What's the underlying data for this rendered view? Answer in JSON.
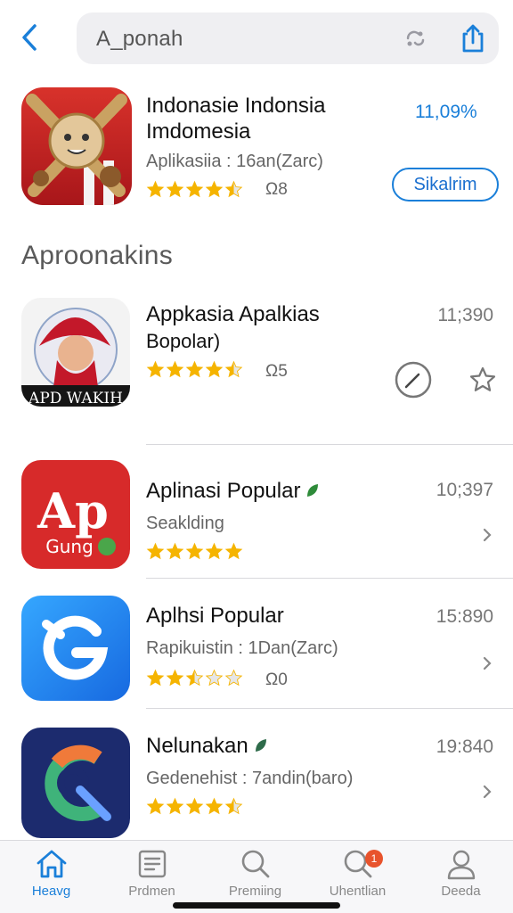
{
  "search": {
    "query": "A_ponah"
  },
  "featured": {
    "title": "Indonasie Indonsia Imdomesia",
    "subtitle": "Aplikasiia : 16an(Zarc)",
    "rating": 4.5,
    "rating_count": "Ω8",
    "percent": "11,09%",
    "button_label": "Sikalrim"
  },
  "section": {
    "heading": "Aproonakins"
  },
  "apps": [
    {
      "title": "Appkasia Apalkias",
      "subtitle": "Bopolar)",
      "rating": 4.5,
      "count": "Ω5",
      "number": "11;390",
      "trailing": "actions"
    },
    {
      "title": "Aplinasi Popular",
      "subtitle": "Seaklding",
      "rating": 5,
      "count": "",
      "number": "10;397",
      "trailing": "chevron"
    },
    {
      "title": "Aplhsi Popular",
      "subtitle": "Rapikuistin : 1Dan(Zarc)",
      "rating": 2.5,
      "count": "Ω0",
      "number": "15:890",
      "trailing": "chevron"
    },
    {
      "title": "Nelunakan",
      "subtitle": "Gedenehist : 7andin(baro)",
      "rating": 4.5,
      "count": "",
      "number": "19:840",
      "trailing": "chevron"
    }
  ],
  "app_icon_text": {
    "app1": "APD WAKIH",
    "app2_big": "Ap",
    "app2_small": "Gung"
  },
  "tabs": [
    {
      "label": "Heavg",
      "icon": "home-icon",
      "active": true
    },
    {
      "label": "Prdmen",
      "icon": "news-icon",
      "active": false
    },
    {
      "label": "Premiing",
      "icon": "search-icon",
      "active": false
    },
    {
      "label": "Uhentlian",
      "icon": "notification-search-icon",
      "active": false,
      "badge": "1"
    },
    {
      "label": "Deeda",
      "icon": "profile-icon",
      "active": false
    }
  ],
  "colors": {
    "accent": "#1a7fd9",
    "star": "#f5b400",
    "badge": "#e8532c"
  }
}
